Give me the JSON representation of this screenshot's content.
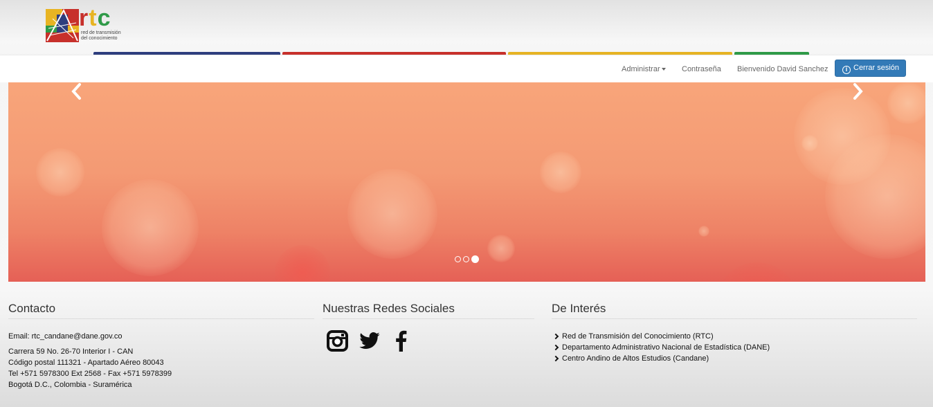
{
  "brand": {
    "logo_text": "rtc",
    "tagline_line1": "red de transmisión",
    "tagline_line2": "del conocimiento"
  },
  "colors": {
    "bar_blue": "#2e3e7e",
    "bar_red": "#c7302b",
    "bar_yellow": "#e6b323",
    "bar_green": "#2f9a48",
    "primary_button": "#337ab7"
  },
  "nav": {
    "admin_label": "Administrar",
    "password_label": "Contraseña",
    "welcome_label": "Bienvenido David Sanchez",
    "logout_label": "Cerrar sesión",
    "logout_icon": "info-icon"
  },
  "carousel": {
    "prev_icon": "chevron-left-icon",
    "next_icon": "chevron-right-icon",
    "slide_count": 3,
    "active_slide": 3
  },
  "footer": {
    "contact": {
      "title": "Contacto",
      "email": "Email: rtc_candane@dane.gov.co",
      "address_line1": "Carrera 59 No. 26-70 Interior I - CAN",
      "address_line2": "Código postal 111321 - Apartado Aéreo 80043",
      "address_line3": "Tel +571 5978300 Ext 2568 - Fax +571 5978399",
      "address_line4": "Bogotá D.C., Colombia - Suramérica"
    },
    "social": {
      "title": "Nuestras Redes Sociales",
      "icons": [
        "instagram-icon",
        "twitter-icon",
        "facebook-icon"
      ]
    },
    "interest": {
      "title": "De Interés",
      "links": [
        "Red de Transmisión del Conocimiento (RTC)",
        "Departamento Administrativo Nacional de Estadística (DANE)",
        "Centro Andino de Altos Estudios (Candane)"
      ]
    }
  }
}
